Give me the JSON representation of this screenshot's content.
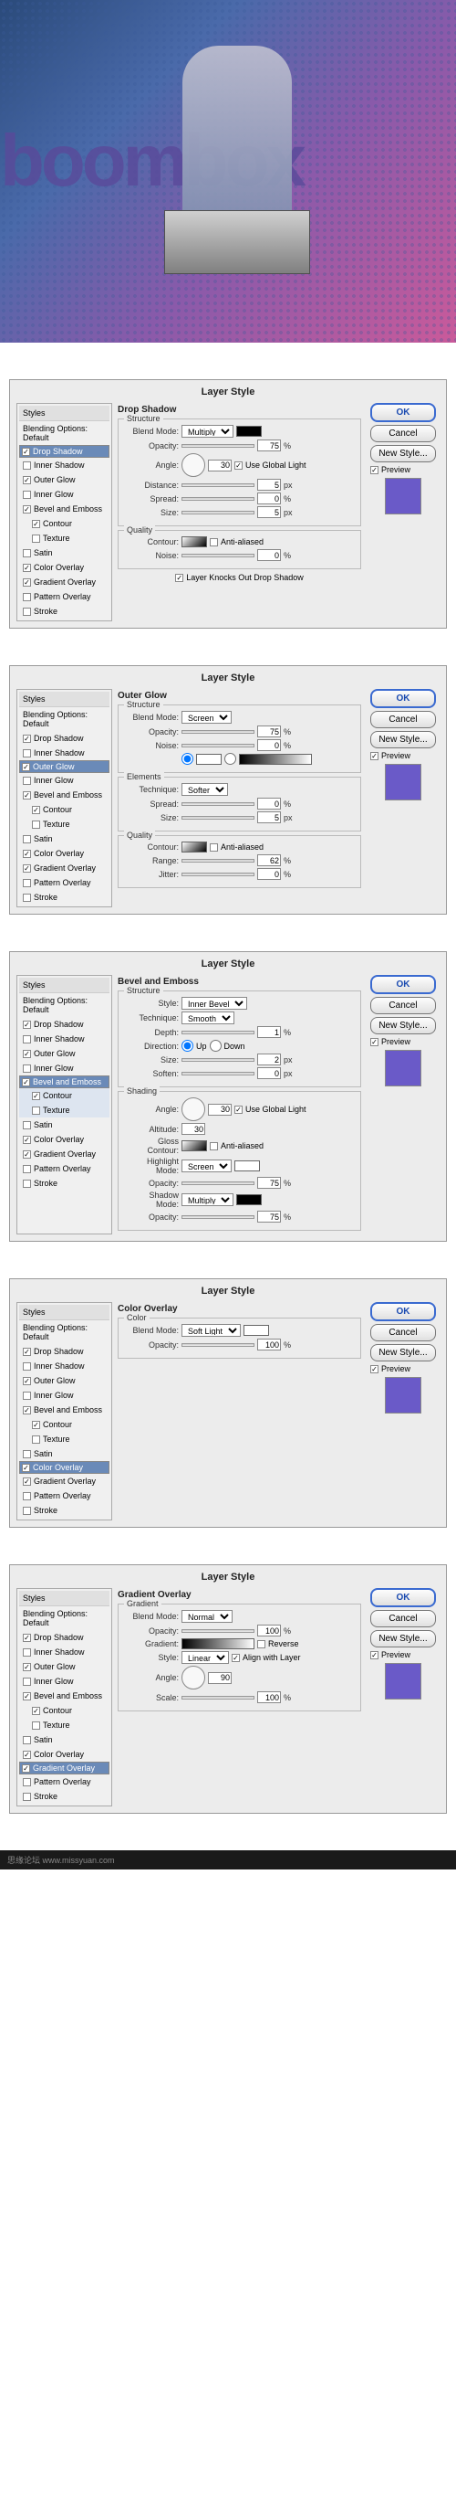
{
  "hero": {
    "text": "boombox"
  },
  "common": {
    "title": "Layer Style",
    "stylesHead": "Styles",
    "blending": "Blending Options: Default",
    "ok": "OK",
    "cancel": "Cancel",
    "newStyle": "New Style...",
    "preview": "Preview"
  },
  "fx": {
    "dropShadow": "Drop Shadow",
    "innerShadow": "Inner Shadow",
    "outerGlow": "Outer Glow",
    "innerGlow": "Inner Glow",
    "bevelEmboss": "Bevel and Emboss",
    "contour": "Contour",
    "texture": "Texture",
    "satin": "Satin",
    "colorOverlay": "Color Overlay",
    "gradientOverlay": "Gradient Overlay",
    "patternOverlay": "Pattern Overlay",
    "stroke": "Stroke"
  },
  "d1": {
    "head": "Drop Shadow",
    "structure": "Structure",
    "blendMode": "Blend Mode:",
    "blendVal": "Multiply",
    "opacity": "Opacity:",
    "opacityVal": "75",
    "angle": "Angle:",
    "angleVal": "30",
    "useGlobal": "Use Global Light",
    "distance": "Distance:",
    "distanceVal": "5",
    "spread": "Spread:",
    "spreadVal": "0",
    "size": "Size:",
    "sizeVal": "5",
    "quality": "Quality",
    "contourLab": "Contour:",
    "antiAliased": "Anti-aliased",
    "noise": "Noise:",
    "noiseVal": "0",
    "knockout": "Layer Knocks Out Drop Shadow"
  },
  "d2": {
    "head": "Outer Glow",
    "structure": "Structure",
    "blendMode": "Blend Mode:",
    "blendVal": "Screen",
    "opacity": "Opacity:",
    "opacityVal": "75",
    "noise": "Noise:",
    "noiseVal": "0",
    "elements": "Elements",
    "technique": "Technique:",
    "techVal": "Softer",
    "spread": "Spread:",
    "spreadVal": "0",
    "size": "Size:",
    "sizeVal": "5",
    "quality": "Quality",
    "contourLab": "Contour:",
    "antiAliased": "Anti-aliased",
    "range": "Range:",
    "rangeVal": "62",
    "jitter": "Jitter:",
    "jitterVal": "0"
  },
  "d3": {
    "head": "Bevel and Emboss",
    "structure": "Structure",
    "style": "Style:",
    "styleVal": "Inner Bevel",
    "technique": "Technique:",
    "techVal": "Smooth",
    "depth": "Depth:",
    "depthVal": "1",
    "direction": "Direction:",
    "up": "Up",
    "down": "Down",
    "size": "Size:",
    "sizeVal": "2",
    "soften": "Soften:",
    "softenVal": "0",
    "shading": "Shading",
    "angle": "Angle:",
    "angleVal": "30",
    "useGlobal": "Use Global Light",
    "altitude": "Altitude:",
    "altVal": "30",
    "glossContour": "Gloss Contour:",
    "antiAliased": "Anti-aliased",
    "highlightMode": "Highlight Mode:",
    "highlightVal": "Screen",
    "hOpacity": "Opacity:",
    "hOpacityVal": "75",
    "shadowMode": "Shadow Mode:",
    "shadowVal": "Multiply",
    "sOpacity": "Opacity:",
    "sOpacityVal": "75"
  },
  "d4": {
    "head": "Color Overlay",
    "color": "Color",
    "blendMode": "Blend Mode:",
    "blendVal": "Soft Light",
    "opacity": "Opacity:",
    "opacityVal": "100"
  },
  "d5": {
    "head": "Gradient Overlay",
    "gradient": "Gradient",
    "blendMode": "Blend Mode:",
    "blendVal": "Normal",
    "opacity": "Opacity:",
    "opacityVal": "100",
    "gradientLab": "Gradient:",
    "reverse": "Reverse",
    "style": "Style:",
    "styleVal": "Linear",
    "alignLayer": "Align with Layer",
    "angle": "Angle:",
    "angleVal": "90",
    "scale": "Scale:",
    "scaleVal": "100"
  },
  "footer": {
    "text": "思缘论坛   www.missyuan.com"
  }
}
